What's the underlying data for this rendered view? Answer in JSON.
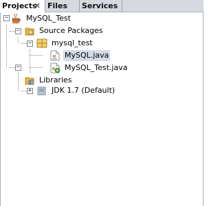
{
  "tabs": [
    {
      "label": "Projects",
      "close": "✕",
      "active": true
    },
    {
      "label": "Files",
      "active": false
    },
    {
      "label": "Services",
      "active": false
    }
  ],
  "tree": {
    "project": {
      "label": "MySQL_Test",
      "icon": "coffee-cup-project-icon",
      "expanded": true
    },
    "source_packages": {
      "label": "Source Packages",
      "icon": "source-packages-folder-icon",
      "expanded": true
    },
    "package": {
      "label": "mysql_test",
      "icon": "package-icon",
      "expanded": true
    },
    "files": [
      {
        "label": "MySQL.java",
        "icon": "java-file-icon",
        "selected": true
      },
      {
        "label": "MySQL_Test.java",
        "icon": "java-main-class-icon",
        "selected": false
      }
    ],
    "libraries": {
      "label": "Libraries",
      "icon": "libraries-folder-icon",
      "expanded": true
    },
    "jdk": {
      "label": "JDK 1.7 (Default)",
      "icon": "jar-library-icon",
      "expanded": false
    }
  },
  "toggle_symbols": {
    "expanded": "−",
    "collapsed": "+"
  },
  "colors": {
    "selection": "#d4dce8",
    "tab_bar": "#d6d9df",
    "folder": "#e8b84a"
  }
}
